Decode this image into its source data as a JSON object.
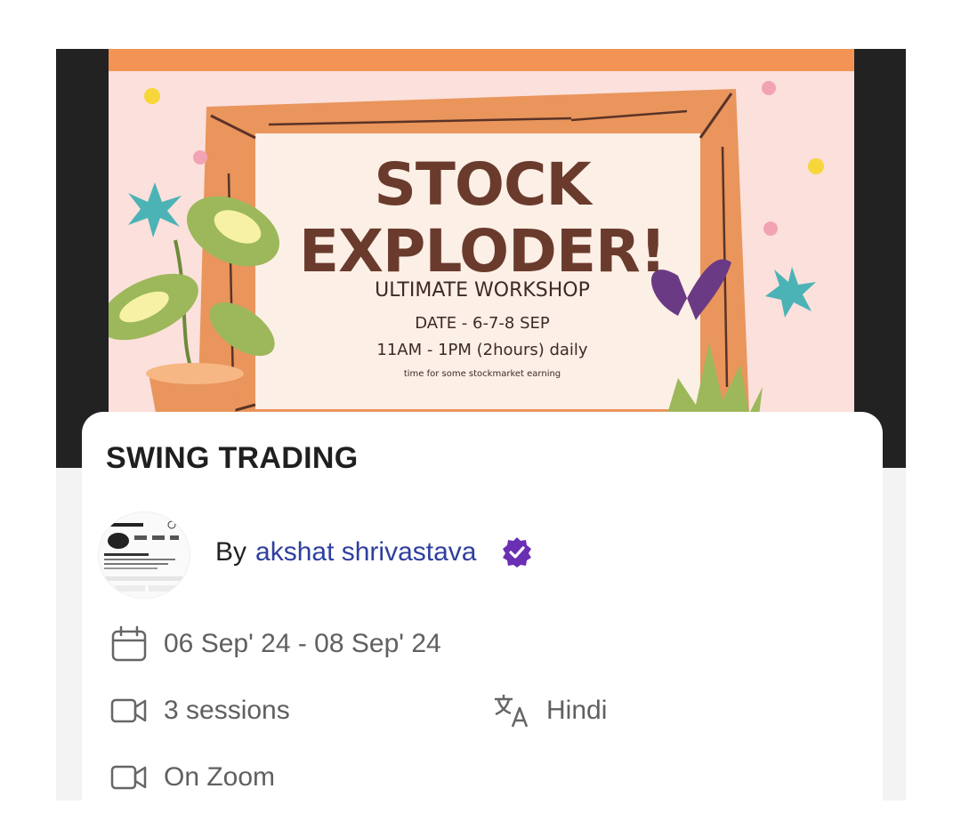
{
  "banner": {
    "poster_line1": "STOCK",
    "poster_line2": "EXPLODER!",
    "poster_subtitle": "ULTIMATE WORKSHOP",
    "poster_date": "DATE - 6-7-8 SEP",
    "poster_time": "11AM - 1PM (2hours) daily",
    "poster_tagline": "time for some stockmarket earning"
  },
  "event": {
    "title": "SWING TRADING",
    "by_label": "By",
    "author": "akshat shrivastava",
    "date_range": "06 Sep' 24 - 08 Sep' 24",
    "sessions": "3 sessions",
    "language": "Hindi",
    "platform": "On Zoom"
  },
  "colors": {
    "author_link": "#2f3f9e",
    "verified_badge": "#6b2fb3",
    "banner_bg": "#fbe0dc",
    "banner_top_strip": "#f39455"
  }
}
